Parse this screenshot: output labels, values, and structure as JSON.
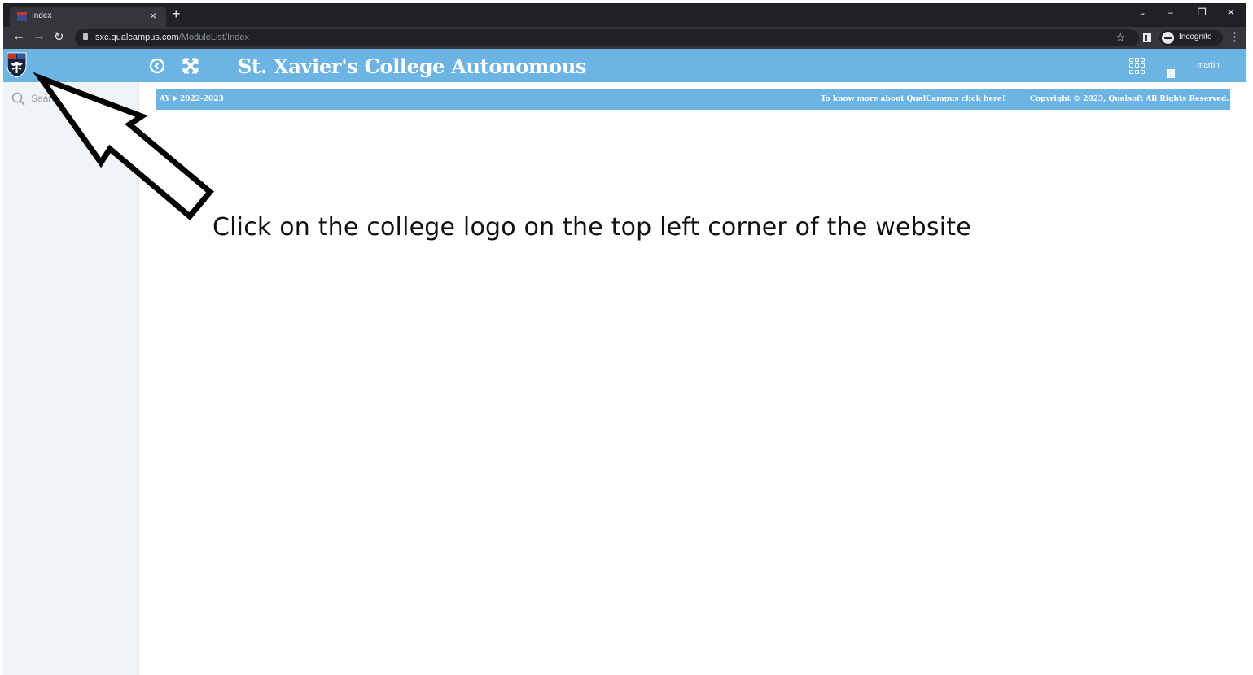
{
  "browser": {
    "tab_title": "Index",
    "tab_close": "×",
    "new_tab": "+",
    "url_host": "sxc.qualcampus.com",
    "url_path": "/ModuleList/Index",
    "incognito_label": "Incognito",
    "icons": [
      "back-arrow-icon",
      "forward-arrow-icon",
      "reload-icon",
      "lock-icon",
      "bookmark-star-icon",
      "side-panel-icon",
      "incognito-icon",
      "menu-kebab-icon",
      "minimize-icon",
      "restore-icon",
      "close-icon"
    ]
  },
  "header": {
    "title": "St. Xavier's College Autonomous",
    "user_name": "martin",
    "color": "#6cb4e4"
  },
  "sidebar": {
    "search_placeholder": "Search..."
  },
  "infobar": {
    "ay_label": "AY",
    "academic_year": "2022-2023",
    "know_more_link": "To know more about QualCampus click here!",
    "copyright": "Copyright © 2023, Qualsoft All Rights Reserved."
  },
  "annotation": {
    "instruction": "Click on the college logo on the top left corner of the website"
  }
}
